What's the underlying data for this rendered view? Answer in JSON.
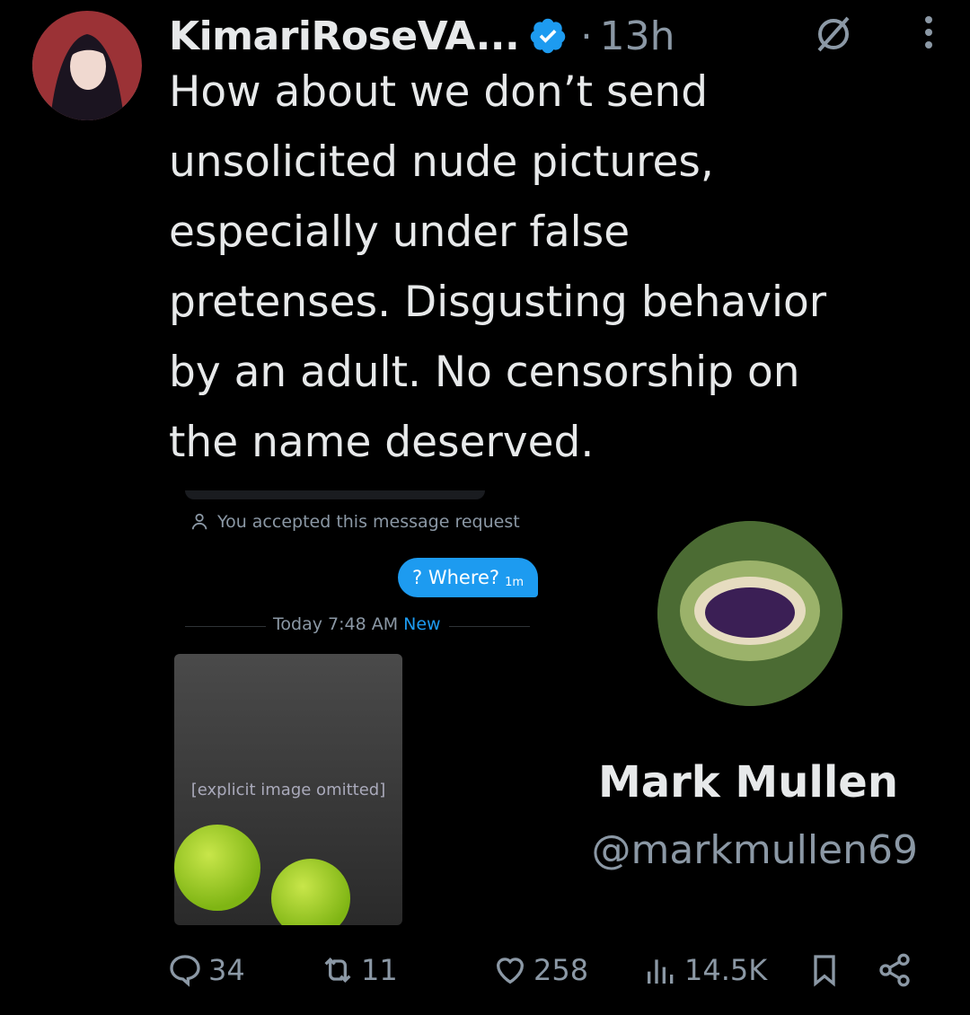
{
  "tweet": {
    "display_name": "KimariRoseVA...",
    "time": "13h",
    "separator": "·",
    "text": "How about we don’t send\nunsolicited nude pictures,\nespecially under false\npretenses. Disgusting behavior\nby an adult. No censorship on\nthe name deserved."
  },
  "embedded_dm": {
    "accepted_notice": "You accepted this message request",
    "message": "? Where?",
    "message_time": "1m",
    "divider_label": "Today 7:48 AM",
    "divider_new": "New",
    "photo_note": "[explicit image omitted]"
  },
  "profile_card": {
    "name": "Mark Mullen",
    "handle": "@markmullen69"
  },
  "actions": {
    "replies": "34",
    "reposts": "11",
    "likes": "258",
    "views": "14.5K"
  },
  "icons": [
    "verified-badge-icon",
    "grok-icon",
    "more-icon",
    "person-icon",
    "reply-icon",
    "repost-icon",
    "like-icon",
    "views-icon",
    "bookmark-icon",
    "share-icon",
    "nauseated-face-icon"
  ],
  "colors": {
    "background": "#000000",
    "text": "#e7e9ea",
    "muted": "#8b98a5",
    "accent": "#1d9bf0"
  }
}
